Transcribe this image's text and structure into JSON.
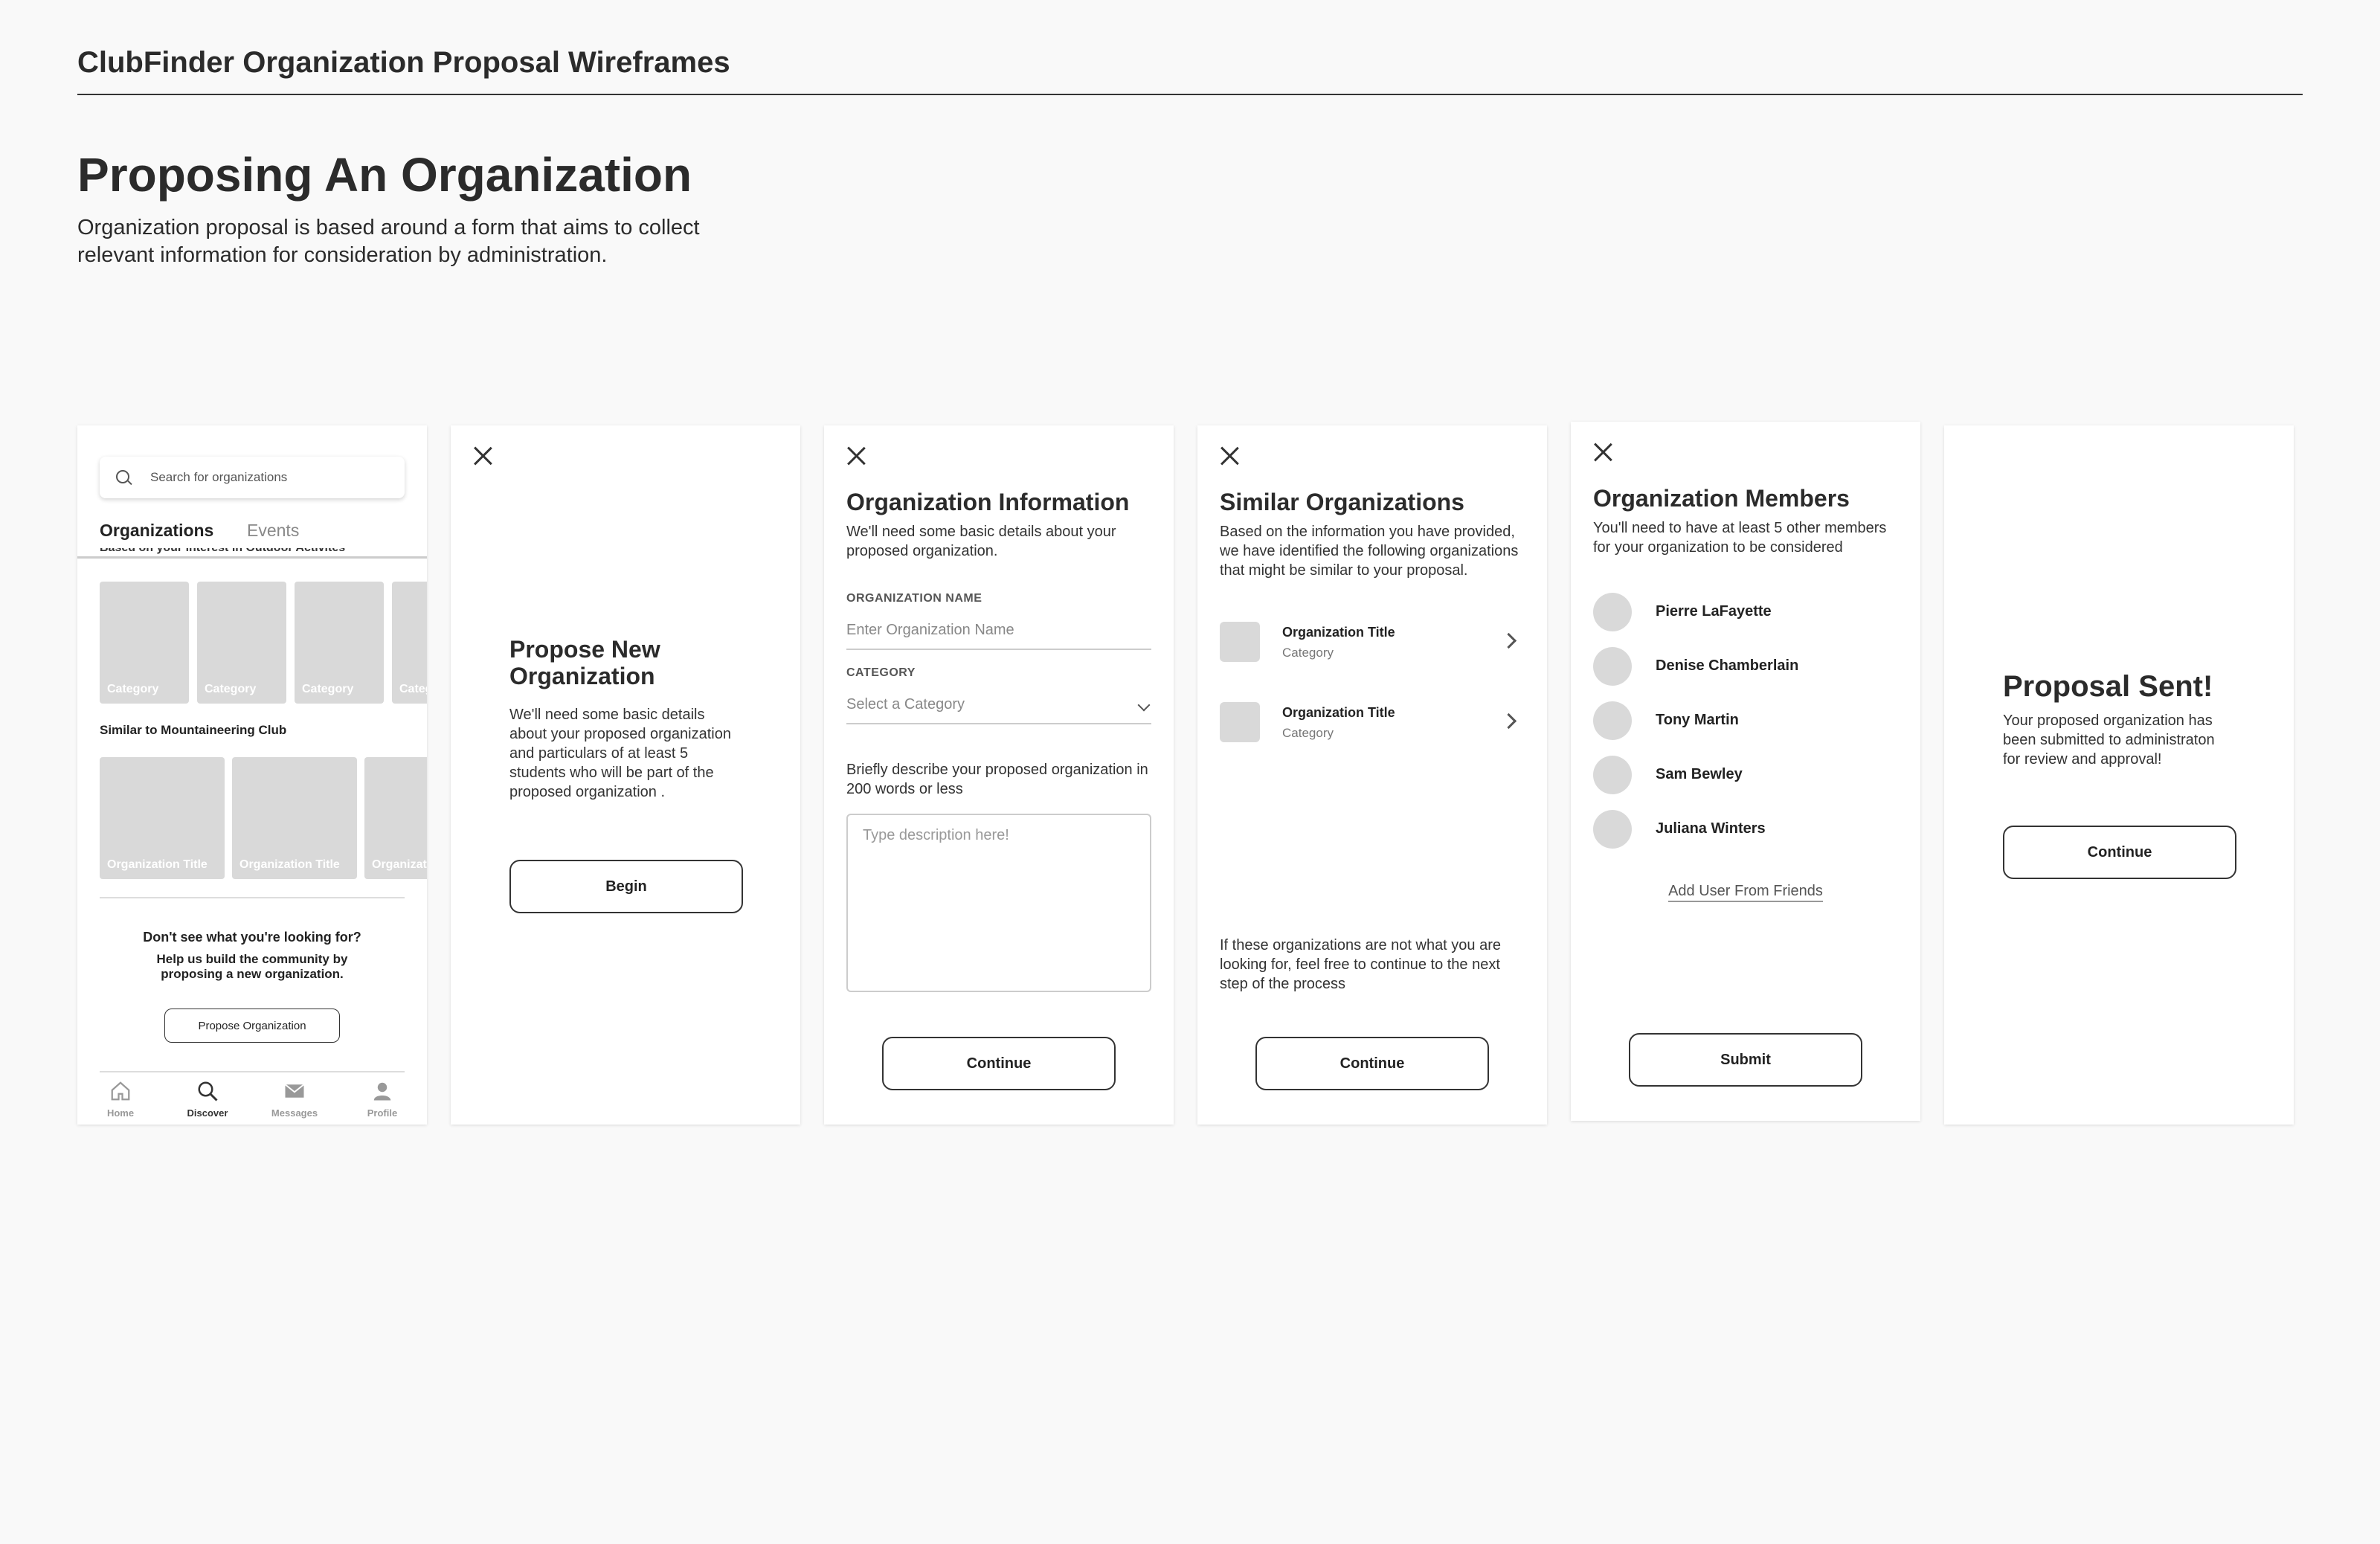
{
  "header": {
    "title": "ClubFinder Organization Proposal Wireframes",
    "section_title": "Proposing An Organization",
    "section_desc": "Organization proposal is based around a form that aims to collect relevant information for consideration by administration."
  },
  "discover": {
    "search_placeholder": "Search for organizations",
    "tabs": [
      "Organizations",
      "Events"
    ],
    "cut_label": "Based on your interest in Outdoor Activites",
    "category_tiles": [
      "Category",
      "Category",
      "Category",
      "Category"
    ],
    "similar_label": "Similar to Mountaineering Club",
    "org_tiles": [
      "Organization Title",
      "Organization Title",
      "Organization Title"
    ],
    "prompt_title": "Don't see what you're looking for?",
    "prompt_line1": "Help us build the community by",
    "prompt_line2": "proposing a new organization.",
    "propose_button": "Propose Organization",
    "nav": [
      "Home",
      "Discover",
      "Messages",
      "Profile"
    ]
  },
  "propose": {
    "title_line1": "Propose New",
    "title_line2": "Organization",
    "desc": "We'll need some basic details about your proposed organization and particulars of at least 5 students who will be part of the proposed organization .",
    "begin_button": "Begin"
  },
  "info": {
    "title": "Organization Information",
    "subtitle": "We'll need some basic details about your proposed organization.",
    "name_label": "ORGANIZATION NAME",
    "name_placeholder": "Enter Organization Name",
    "category_label": "CATEGORY",
    "category_placeholder": "Select a Category",
    "describe_prompt": "Briefly describe your proposed organization in 200 words or less",
    "description_placeholder": "Type description here!",
    "continue_button": "Continue"
  },
  "similar": {
    "title": "Similar Organizations",
    "subtitle": "Based on the information you have provided, we have identified the following organizations that might be similar to your proposal.",
    "orgs": [
      {
        "title": "Organization Title",
        "category": "Category"
      },
      {
        "title": "Organization Title",
        "category": "Category"
      }
    ],
    "footer": "If these organizations are not what you are looking for, feel free to continue to the next step of the process",
    "continue_button": "Continue"
  },
  "members": {
    "title": "Organization Members",
    "subtitle": "You'll need to have at least 5 other members for your organization to be considered",
    "names": [
      "Pierre LaFayette",
      "Denise Chamberlain",
      "Tony Martin",
      "Sam Bewley",
      "Juliana Winters"
    ],
    "add_link": "Add User From Friends",
    "submit_button": "Submit"
  },
  "sent": {
    "title": "Proposal Sent!",
    "desc": "Your proposed organization has been submitted to administraton for review and approval!",
    "continue_button": "Continue"
  }
}
